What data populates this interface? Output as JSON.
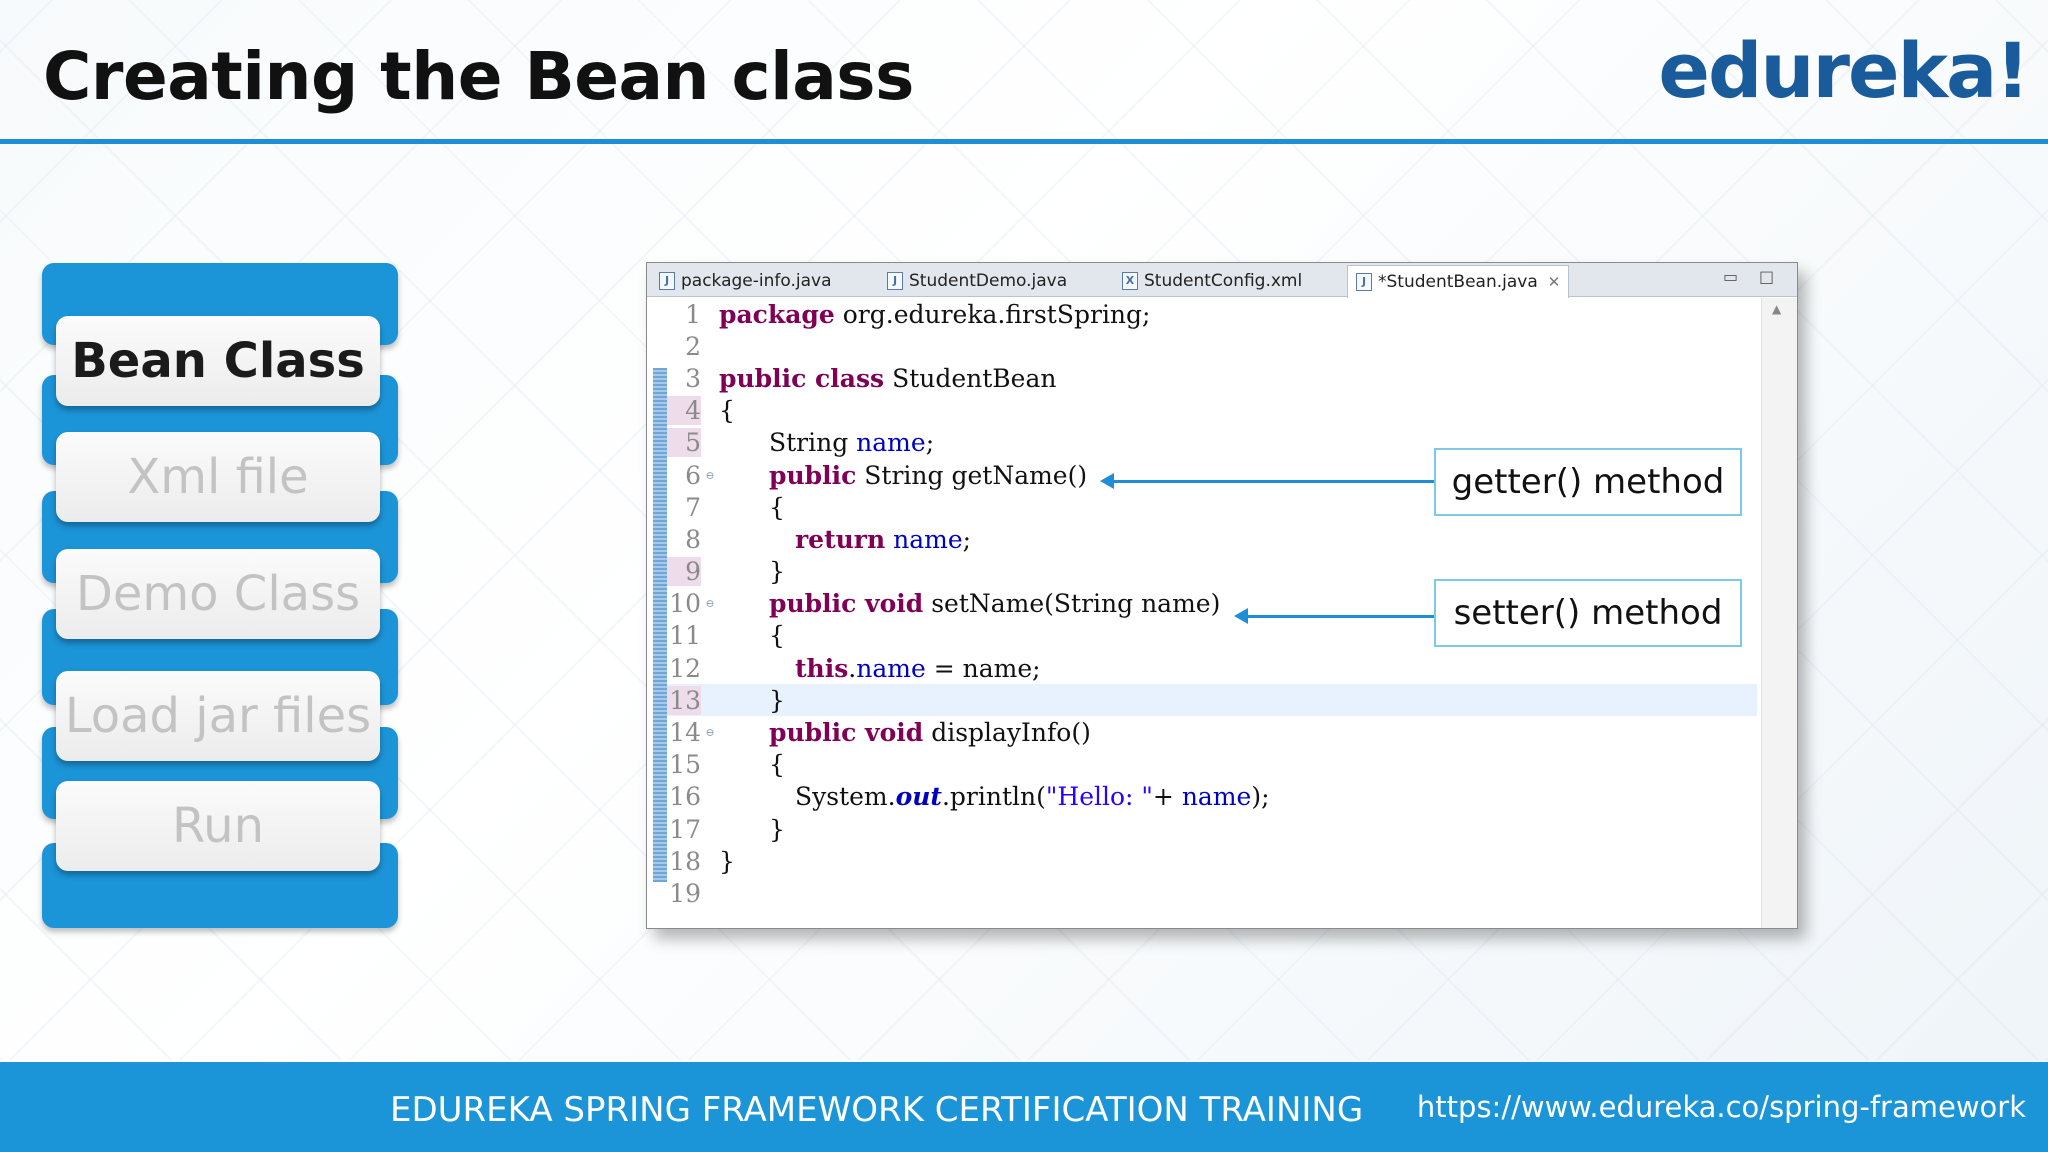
{
  "slide": {
    "title": "Creating the Bean class",
    "logo": "edureka!",
    "accent_color": "#1e8fd5",
    "brand_color": "#1a5b9b"
  },
  "sidebar": {
    "items": [
      {
        "label": "Bean Class",
        "active": true
      },
      {
        "label": "Xml file",
        "active": false
      },
      {
        "label": "Demo Class",
        "active": false
      },
      {
        "label": "Load jar files",
        "active": false
      },
      {
        "label": "Run",
        "active": false
      }
    ]
  },
  "ide": {
    "tabs": [
      {
        "label": "package-info.java",
        "icon": "java-file-icon"
      },
      {
        "label": "StudentDemo.java",
        "icon": "java-file-icon"
      },
      {
        "label": "StudentConfig.xml",
        "icon": "xml-file-icon"
      },
      {
        "label": "*StudentBean.java",
        "icon": "java-file-icon",
        "active": true
      }
    ],
    "code_lines": [
      "1",
      "2",
      "3",
      "4",
      "5",
      "6",
      "7",
      "8",
      "9",
      "10",
      "11",
      "12",
      "13",
      "14",
      "15",
      "16",
      "17",
      "18",
      "19"
    ],
    "code": {
      "l1_kw": "package",
      "l1_rest": " org.edureka.firstSpring;",
      "l3_kw": "public class",
      "l3_rest": " StudentBean",
      "l4": "{",
      "l5_type": "String ",
      "l5_field": "name",
      "l5_end": ";",
      "l6_kw": "public",
      "l6_rest": " String getName()",
      "l7": "{",
      "l8_kw": "return",
      "l8_sp": " ",
      "l8_field": "name",
      "l8_end": ";",
      "l9": "}",
      "l10_kw": "public void",
      "l10_rest": " setName(String name)",
      "l11": "{",
      "l12_kw": "this",
      "l12_dot": ".",
      "l12_field": "name",
      "l12_rest": " = name;",
      "l13": "}",
      "l14_kw": "public void",
      "l14_rest": " displayInfo()",
      "l15": "{",
      "l16_a": "System.",
      "l16_out": "out",
      "l16_b": ".println(",
      "l16_str": "\"Hello: \"",
      "l16_c": "+ ",
      "l16_field": "name",
      "l16_d": ");",
      "l17": "}",
      "l18": "}"
    }
  },
  "callouts": {
    "getter": "getter() method",
    "setter": "setter() method"
  },
  "footer": {
    "course": "EDUREKA SPRING FRAMEWORK CERTIFICATION TRAINING",
    "url": "https://www.edureka.co/spring-framework"
  }
}
